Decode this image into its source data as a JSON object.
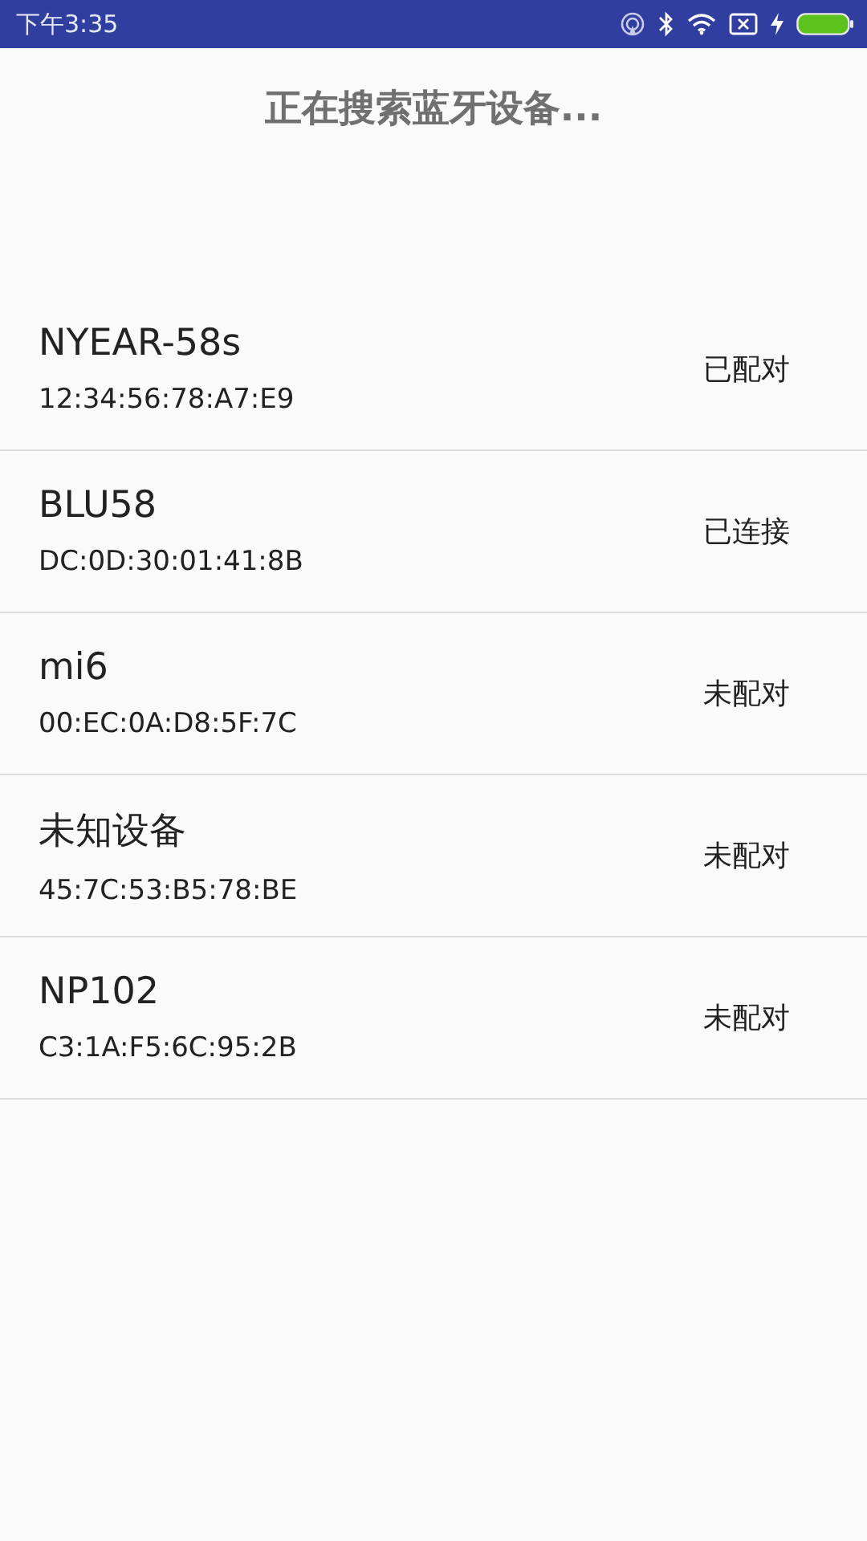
{
  "status_bar": {
    "time": "下午3:35"
  },
  "title": "正在搜索蓝牙设备...",
  "devices": [
    {
      "name": "NYEAR-58s",
      "address": "12:34:56:78:A7:E9",
      "status": "已配对"
    },
    {
      "name": "BLU58",
      "address": "DC:0D:30:01:41:8B",
      "status": "已连接"
    },
    {
      "name": "mi6",
      "address": "00:EC:0A:D8:5F:7C",
      "status": "未配对"
    },
    {
      "name": "未知设备",
      "address": "45:7C:53:B5:78:BE",
      "status": "未配对"
    },
    {
      "name": "NP102",
      "address": "C3:1A:F5:6C:95:2B",
      "status": "未配对"
    }
  ]
}
